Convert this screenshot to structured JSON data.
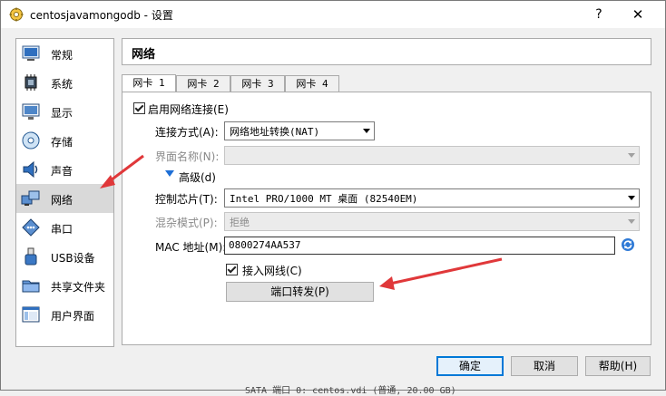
{
  "window": {
    "title": "centosjavamongodb - 设置",
    "help_label": "?",
    "close_label": "✕"
  },
  "sidebar": {
    "items": [
      {
        "label": "常规",
        "icon": "general-icon"
      },
      {
        "label": "系统",
        "icon": "system-icon"
      },
      {
        "label": "显示",
        "icon": "display-icon"
      },
      {
        "label": "存储",
        "icon": "storage-icon"
      },
      {
        "label": "声音",
        "icon": "audio-icon"
      },
      {
        "label": "网络",
        "icon": "network-icon",
        "active": true
      },
      {
        "label": "串口",
        "icon": "serial-port-icon"
      },
      {
        "label": "USB设备",
        "icon": "usb-icon"
      },
      {
        "label": "共享文件夹",
        "icon": "shared-folder-icon"
      },
      {
        "label": "用户界面",
        "icon": "user-interface-icon"
      }
    ]
  },
  "section": {
    "title": "网络"
  },
  "tabs": [
    {
      "label": "网卡 1",
      "active": true
    },
    {
      "label": "网卡 2"
    },
    {
      "label": "网卡 3"
    },
    {
      "label": "网卡 4"
    }
  ],
  "form": {
    "enable_network": {
      "label": "启用网络连接(E)",
      "checked": true
    },
    "attached_to": {
      "label": "连接方式(A):",
      "value": "网络地址转换(NAT)"
    },
    "interface_name": {
      "label": "界面名称(N):",
      "value": ""
    },
    "advanced": {
      "label": "高级(d)"
    },
    "adapter_type": {
      "label": "控制芯片(T):",
      "value": "Intel PRO/1000 MT 桌面 (82540EM)"
    },
    "promiscuous": {
      "label": "混杂模式(P):",
      "value": "拒绝"
    },
    "mac": {
      "label": "MAC 地址(M):",
      "value": "0800274AA537"
    },
    "cable_connected": {
      "label": "接入网线(C)",
      "checked": true
    },
    "port_forwarding": {
      "label": "端口转发(P)"
    }
  },
  "buttons": {
    "ok": "确定",
    "cancel": "取消",
    "help": "帮助(H)"
  },
  "background_status": "SATA 端口 0:          centos.vdi (普通, 20.00 GB)",
  "colors": {
    "annotation_arrow": "#e0383a",
    "accent": "#0078d7"
  }
}
